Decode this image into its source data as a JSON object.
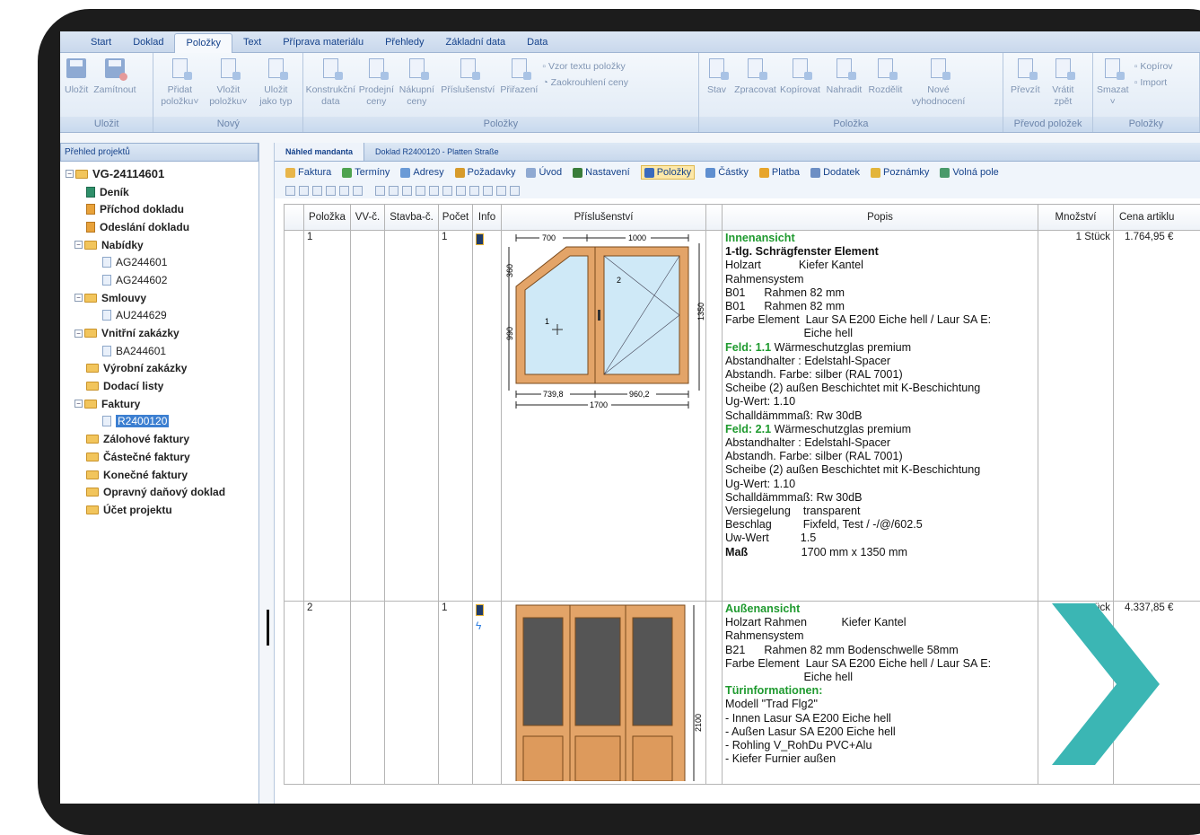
{
  "ribbon": {
    "tabs": [
      {
        "label": "Start",
        "active": false
      },
      {
        "label": "Doklad",
        "active": false
      },
      {
        "label": "Položky",
        "active": true
      },
      {
        "label": "Text",
        "active": false
      },
      {
        "label": "Příprava materiálu",
        "active": false
      },
      {
        "label": "Přehledy",
        "active": false
      },
      {
        "label": "Základní data",
        "active": false
      },
      {
        "label": "Data",
        "active": false
      }
    ],
    "groups": {
      "ulozit": {
        "title": "Uložit",
        "save": "Uložit",
        "reject": "Zamítnout"
      },
      "novy": {
        "title": "Nový",
        "add": "Přidat\npoložku˅",
        "insert": "Vložit\npoložku˅",
        "save_type": "Uložit\njako typ"
      },
      "polozky": {
        "title": "Položky",
        "construction": "Konstrukční\ndata",
        "sale": "Prodejní\nceny",
        "purchase": "Nákupní\nceny",
        "accessories": "Příslušenství",
        "assign": "Přiřazení",
        "text_template": "Vzor textu položky",
        "rounding": "Zaokrouhlení ceny"
      },
      "polozka": {
        "title": "Položka",
        "state": "Stav",
        "process": "Zpracovat",
        "copy": "Kopírovat",
        "replace": "Nahradit",
        "split": "Rozdělit",
        "new_eval": "Nové\nvyhodnocení"
      },
      "prevod": {
        "title": "Převod položek",
        "take": "Převzít",
        "return": "Vrátit\nzpět"
      },
      "polozky2": {
        "title": "Položky",
        "delete": "Smazat\n˅",
        "copy": "Kopírov",
        "import": "Import"
      }
    }
  },
  "left_panel": {
    "title": "Přehled projektů",
    "nodes": [
      {
        "label": "VG-24114601",
        "bold": true,
        "big": true,
        "depth": 0,
        "icon": "folder",
        "expander": "−"
      },
      {
        "label": "Deník",
        "bold": true,
        "depth": 1,
        "icon": "doc-green"
      },
      {
        "label": "Příchod dokladu",
        "bold": true,
        "depth": 1,
        "icon": "doc-orange"
      },
      {
        "label": "Odeslání dokladu",
        "bold": true,
        "depth": 1,
        "icon": "doc-orange"
      },
      {
        "label": "Nabídky",
        "bold": true,
        "depth": 1,
        "icon": "folder",
        "expander": "−"
      },
      {
        "label": "AG244601",
        "bold": false,
        "depth": 2,
        "icon": "doc"
      },
      {
        "label": "AG244602",
        "bold": false,
        "depth": 2,
        "icon": "doc"
      },
      {
        "label": "Smlouvy",
        "bold": true,
        "depth": 1,
        "icon": "folder",
        "expander": "−"
      },
      {
        "label": "AU244629",
        "bold": false,
        "depth": 2,
        "icon": "doc"
      },
      {
        "label": "Vnitřní zakázky",
        "bold": true,
        "depth": 1,
        "icon": "folder",
        "expander": "−"
      },
      {
        "label": "BA244601",
        "bold": false,
        "depth": 2,
        "icon": "doc"
      },
      {
        "label": "Výrobní zakázky",
        "bold": true,
        "depth": 1,
        "icon": "folder"
      },
      {
        "label": "Dodací listy",
        "bold": true,
        "depth": 1,
        "icon": "folder"
      },
      {
        "label": "Faktury",
        "bold": true,
        "depth": 1,
        "icon": "folder",
        "expander": "−"
      },
      {
        "label": "R2400120",
        "bold": false,
        "depth": 2,
        "icon": "doc",
        "selected": true
      },
      {
        "label": "Zálohové faktury",
        "bold": true,
        "depth": 1,
        "icon": "folder"
      },
      {
        "label": "Částečné faktury",
        "bold": true,
        "depth": 1,
        "icon": "folder"
      },
      {
        "label": "Konečné faktury",
        "bold": true,
        "depth": 1,
        "icon": "folder"
      },
      {
        "label": "Opravný daňový doklad",
        "bold": true,
        "depth": 1,
        "icon": "folder"
      },
      {
        "label": "Účet projektu",
        "bold": true,
        "depth": 1,
        "icon": "folder"
      }
    ]
  },
  "doc_tabs": [
    {
      "label": "Náhled mandanta",
      "active": true
    },
    {
      "label": "Doklad R2400120 - Platten Straße",
      "active": false
    }
  ],
  "sections": [
    {
      "label": "Faktura",
      "color": "#e8b64a"
    },
    {
      "label": "Termíny",
      "color": "#4fa34f"
    },
    {
      "label": "Adresy",
      "color": "#6a9ad6"
    },
    {
      "label": "Požadavky",
      "color": "#d79b2b"
    },
    {
      "label": "Úvod",
      "color": "#8fa9d2"
    },
    {
      "label": "Nastavení",
      "color": "#3a7d3a"
    },
    {
      "label": "Položky",
      "color": "#3a6bbd",
      "active": true
    },
    {
      "label": "Částky",
      "color": "#5f8fd0"
    },
    {
      "label": "Platba",
      "color": "#e7a52a"
    },
    {
      "label": "Dodatek",
      "color": "#6d8fc4"
    },
    {
      "label": "Poznámky",
      "color": "#e3b53a"
    },
    {
      "label": "Volná pole",
      "color": "#4a9a6a"
    }
  ],
  "table": {
    "headers": [
      "Položka",
      "VV-č.",
      "Stavba-č.",
      "Počet",
      "Info",
      "Příslušenství",
      "Popis",
      "Množství",
      "Cena artiklu"
    ],
    "rows": [
      {
        "pos": "1",
        "count": "1",
        "qty": "1 Stück",
        "price": "1.764,95 €",
        "drawing": {
          "top_left": "700",
          "top_right": "1000",
          "left_h1": "360",
          "left_h2": "990",
          "right_h": "1350",
          "bottom_left": "739,8",
          "bottom_right": "960,2",
          "bottom_total": "1700",
          "sash1": "1",
          "sash2": "2"
        },
        "desc": [
          {
            "t": "Innenansicht",
            "s": "green"
          },
          {
            "t": "1-tlg. Schrägfenster Element",
            "s": "bold"
          },
          {
            "t": "Holzart            Kiefer Kantel"
          },
          {
            "t": "Rahmensystem"
          },
          {
            "t": "B01      Rahmen 82 mm"
          },
          {
            "t": "B01      Rahmen 82 mm"
          },
          {
            "t": "Farbe Element  Laur SA E200 Eiche hell / Laur SA E:"
          },
          {
            "t": "                         Eiche hell"
          },
          {
            "t": "Feld: 1.1",
            "s": "green",
            "rest": " Wärmeschutzglas premium"
          },
          {
            "t": "Abstandhalter : Edelstahl-Spacer"
          },
          {
            "t": "Abstandh. Farbe: silber (RAL 7001)"
          },
          {
            "t": "Scheibe (2) außen Beschichtet mit K-Beschichtung"
          },
          {
            "t": "Ug-Wert: 1.10"
          },
          {
            "t": "Schalldämmmaß: Rw 30dB"
          },
          {
            "t": "Feld: 2.1",
            "s": "green",
            "rest": " Wärmeschutzglas premium"
          },
          {
            "t": "Abstandhalter : Edelstahl-Spacer"
          },
          {
            "t": "Abstandh. Farbe: silber (RAL 7001)"
          },
          {
            "t": "Scheibe (2) außen Beschichtet mit K-Beschichtung"
          },
          {
            "t": "Ug-Wert: 1.10"
          },
          {
            "t": "Schalldämmmaß: Rw 30dB"
          },
          {
            "t": "Versiegelung    transparent"
          },
          {
            "t": "Beschlag          Fixfeld, Test / -/@/602.5"
          },
          {
            "t": "Uw-Wert          1.5"
          },
          {
            "t": "Maß",
            "s": "bold",
            "rest": "                 1700 mm x 1350 mm"
          }
        ]
      },
      {
        "pos": "2",
        "count": "1",
        "qty": "ück",
        "price": "4.337,85 €",
        "drawing": {
          "right_h": "2100"
        },
        "desc": [
          {
            "t": "Außenansicht",
            "s": "green"
          },
          {
            "t": "Holzart Rahmen           Kiefer Kantel"
          },
          {
            "t": "Rahmensystem"
          },
          {
            "t": "B21      Rahmen 82 mm Bodenschwelle 58mm"
          },
          {
            "t": "Farbe Element  Laur SA E200 Eiche hell / Laur SA E:"
          },
          {
            "t": "                         Eiche hell"
          },
          {
            "t": "Türinformationen:",
            "s": "green"
          },
          {
            "t": "Modell \"Trad Flg2\""
          },
          {
            "t": "- Innen Lasur SA E200 Eiche hell"
          },
          {
            "t": "- Außen Lasur SA E200 Eiche hell"
          },
          {
            "t": "- Rohling V_RohDu PVC+Alu"
          },
          {
            "t": "- Kiefer Furnier außen"
          }
        ]
      }
    ]
  },
  "colors": {
    "accent": "#15428b",
    "green_text": "#1f9a2f",
    "chevron": "#3bb6b4",
    "wood": "#e3a468"
  }
}
